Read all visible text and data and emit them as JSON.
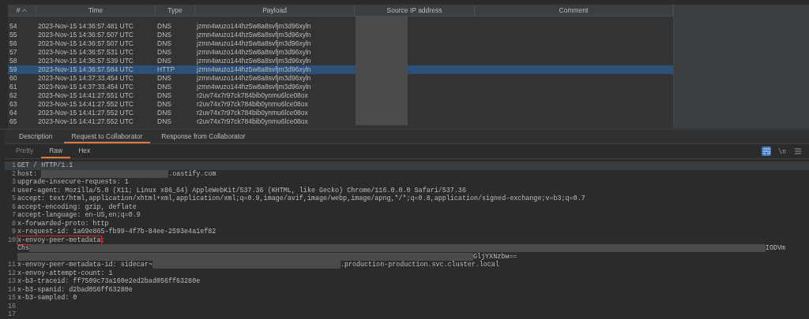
{
  "table": {
    "columns": [
      {
        "label": "#",
        "sorted": true
      },
      {
        "label": "Time",
        "sorted": false
      },
      {
        "label": "Type",
        "sorted": false
      },
      {
        "label": "Payload",
        "sorted": false
      },
      {
        "label": "Source IP address",
        "sorted": false
      },
      {
        "label": "Comment",
        "sorted": false
      }
    ],
    "rows": [
      {
        "number": "54",
        "time": "2023-Nov-15 14:36:57.481 UTC",
        "type": "DNS",
        "payload": "jzmn4wuzo144hz5w8a8svfjm3d96xyln",
        "selected": false
      },
      {
        "number": "55",
        "time": "2023-Nov-15 14:36:57.507 UTC",
        "type": "DNS",
        "payload": "jzmn4wuzo144hz5w8a8svfjm3d96xyln",
        "selected": false
      },
      {
        "number": "56",
        "time": "2023-Nov-15 14:36:57.507 UTC",
        "type": "DNS",
        "payload": "jzmn4wuzo144hz5w8a8svfjm3d96xyln",
        "selected": false
      },
      {
        "number": "57",
        "time": "2023-Nov-15 14:36:57.531 UTC",
        "type": "DNS",
        "payload": "jzmn4wuzo144hz5w8a8svfjm3d96xyln",
        "selected": false
      },
      {
        "number": "58",
        "time": "2023-Nov-15 14:36:57.539 UTC",
        "type": "DNS",
        "payload": "jzmn4wuzo144hz5w8a8svfjm3d96xyln",
        "selected": false
      },
      {
        "number": "59",
        "time": "2023-Nov-15 14:36:57.584 UTC",
        "type": "HTTP",
        "payload": "jzmn4wuzo144hz5w8a8svfjm3d96xyln",
        "selected": true
      },
      {
        "number": "60",
        "time": "2023-Nov-15 14:37:33.454 UTC",
        "type": "DNS",
        "payload": "jzmn4wuzo144hz5w8a8svfjm3d96xyln",
        "selected": false
      },
      {
        "number": "61",
        "time": "2023-Nov-15 14:37:33.454 UTC",
        "type": "DNS",
        "payload": "jzmn4wuzo144hz5w8a8svfjm3d96xyln",
        "selected": false
      },
      {
        "number": "62",
        "time": "2023-Nov-15 14:41:27.551 UTC",
        "type": "DNS",
        "payload": "r2uv74x7r97ck784bib0ynmu6lce08ox",
        "selected": false
      },
      {
        "number": "63",
        "time": "2023-Nov-15 14:41:27.552 UTC",
        "type": "DNS",
        "payload": "r2uv74x7r97ck784bib0ynmu6lce08ox",
        "selected": false
      },
      {
        "number": "64",
        "time": "2023-Nov-15 14:41:27.552 UTC",
        "type": "DNS",
        "payload": "r2uv74x7r97ck784bib0ynmu6lce08ox",
        "selected": false
      },
      {
        "number": "65",
        "time": "2023-Nov-15 14:41:27.552 UTC",
        "type": "DNS",
        "payload": "r2uv74x7r97ck784bib0ynmu6lce08ox",
        "selected": false
      }
    ]
  },
  "tabs": [
    {
      "label": "Description",
      "selected": false
    },
    {
      "label": "Request to Collaborator",
      "selected": true
    },
    {
      "label": "Response from Collaborator",
      "selected": false
    }
  ],
  "view_tabs": [
    {
      "label": "Pretty",
      "selected": false,
      "disabled": true
    },
    {
      "label": "Raw",
      "selected": true,
      "disabled": false
    },
    {
      "label": "Hex",
      "selected": false,
      "disabled": false
    }
  ],
  "toolbar": [
    {
      "kind": "wrap",
      "on": true
    },
    {
      "kind": "text",
      "label": "\\n",
      "on": false
    },
    {
      "kind": "menu",
      "on": false
    }
  ],
  "message": {
    "lines": [
      {
        "number": "1",
        "current": true,
        "segments": [
          {
            "kind": "text",
            "text": "GET / HTTP/1.1"
          }
        ]
      },
      {
        "number": "2",
        "current": false,
        "segments": [
          {
            "kind": "text",
            "text": "host: "
          },
          {
            "kind": "redacted"
          },
          {
            "kind": "text",
            "text": ".oastify.com"
          }
        ]
      },
      {
        "number": "3",
        "current": false,
        "segments": [
          {
            "kind": "text",
            "text": "upgrade-insecure-requests: 1"
          }
        ]
      },
      {
        "number": "4",
        "current": false,
        "segments": [
          {
            "kind": "text",
            "text": "user-agent: Mozilla/5.0 (X11; Linux x86_64) AppleWebKit/537.36 (KHTML, like Gecko) Chrome/116.0.0.0 Safari/537.36"
          }
        ]
      },
      {
        "number": "5",
        "current": false,
        "segments": [
          {
            "kind": "text",
            "text": "accept: text/html,application/xhtml+xml,application/xml;q=0.9,image/avif,image/webp,image/apng,*/*;q=0.8,application/signed-exchange;v=b3;q=0.7"
          }
        ]
      },
      {
        "number": "6",
        "current": false,
        "segments": [
          {
            "kind": "text",
            "text": "accept-encoding: gzip, deflate"
          }
        ]
      },
      {
        "number": "7",
        "current": false,
        "segments": [
          {
            "kind": "text",
            "text": "accept-language: en-US,en;q=0.9"
          }
        ]
      },
      {
        "number": "8",
        "current": false,
        "segments": [
          {
            "kind": "text",
            "text": "x-forwarded-proto: http"
          }
        ]
      },
      {
        "number": "9",
        "current": false,
        "segments": [
          {
            "kind": "text",
            "text": "x-request-id: 1a69e865-fb99-4f7b-84ee-2593e4a1ef82"
          }
        ]
      },
      {
        "number": "10",
        "current": false,
        "segments": [
          {
            "kind": "marked",
            "text": "x-envoy-peer-metadata"
          },
          {
            "kind": "text",
            "text": ":"
          }
        ]
      },
      {
        "current": false,
        "segments": [
          {
            "kind": "text",
            "text": "Chs"
          },
          {
            "kind": "redacted"
          },
          {
            "kind": "text",
            "text": "IODVm"
          }
        ]
      },
      {
        "current": false,
        "segments": [
          {
            "kind": "redacted"
          },
          {
            "kind": "text",
            "text": "GljYXNzbw=="
          }
        ]
      },
      {
        "number": "11",
        "current": false,
        "segments": [
          {
            "kind": "text",
            "text": "x-envoy-peer-metadata-id: sidecar~"
          },
          {
            "kind": "redacted"
          },
          {
            "kind": "text",
            "text": ".production-production.svc.cluster.local"
          }
        ]
      },
      {
        "number": "12",
        "current": false,
        "segments": [
          {
            "kind": "text",
            "text": "x-envoy-attempt-count: 1"
          }
        ]
      },
      {
        "number": "13",
        "current": false,
        "segments": [
          {
            "kind": "text",
            "text": "x-b3-traceid: ff7509c73a160e2ed2bad056ff63280e"
          }
        ]
      },
      {
        "number": "14",
        "current": false,
        "segments": [
          {
            "kind": "text",
            "text": "x-b3-spanid: d2bad056ff63280e"
          }
        ]
      },
      {
        "number": "15",
        "current": false,
        "segments": [
          {
            "kind": "text",
            "text": "x-b3-sampled: 0"
          }
        ]
      },
      {
        "number": "16",
        "current": false
      },
      {
        "number": "17",
        "current": false
      }
    ]
  }
}
